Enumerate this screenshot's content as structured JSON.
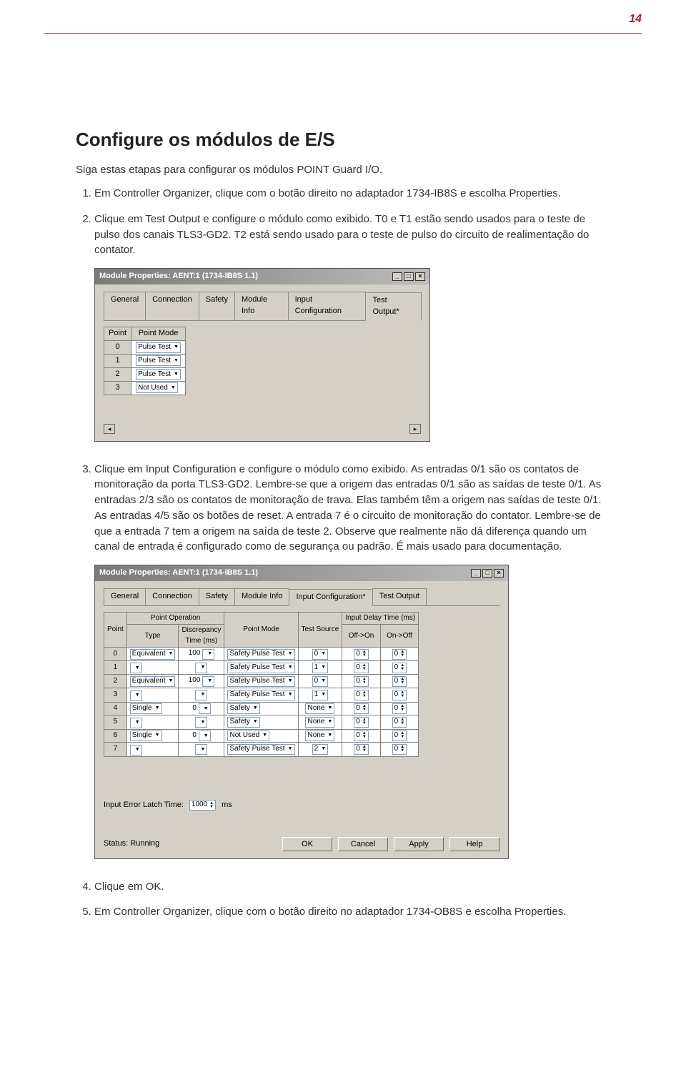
{
  "page_number": "14",
  "title": "Configure os módulos de E/S",
  "subtitle": "Siga estas etapas para configurar os módulos POINT Guard I/O.",
  "steps": {
    "s1": "Em Controller Organizer, clique com o botão direito no adaptador 1734-IB8S e escolha Properties.",
    "s2": "Clique em Test Output e configure o módulo como exibido. T0 e T1 estão sendo usados para o teste de pulso dos canais TLS3-GD2. T2 está sendo usado para o teste de pulso do circuito de realimentação do contator.",
    "s3": "Clique em Input Configuration e configure o módulo como exibido. As entradas 0/1 são os contatos de monitoração da porta TLS3-GD2. Lembre-se que a origem das entradas 0/1 são as saídas de teste 0/1. As entradas 2/3 são os contatos de monitoração de trava. Elas também têm a origem nas saídas de teste 0/1. As entradas 4/5 são os botões de reset. A entrada 7 é o circuito de monitoração do contator. Lembre-se de que a entrada 7 tem a origem na saída de teste 2. Observe que realmente não dá diferença quando um canal de entrada é configurado como de segurança ou padrão. É mais usado para documentação.",
    "s4": "Clique em OK.",
    "s5": "Em Controller Organizer, clique com o botão direito no adaptador 1734-OB8S e escolha Properties."
  },
  "dialog1": {
    "title": "Module Properties: AENT:1 (1734-IB8S 1.1)",
    "tabs": [
      "General",
      "Connection",
      "Safety",
      "Module Info",
      "Input Configuration",
      "Test Output*"
    ],
    "active_tab": 5,
    "col_point": "Point",
    "col_mode": "Point Mode",
    "rows": [
      {
        "idx": "0",
        "mode": "Pulse Test"
      },
      {
        "idx": "1",
        "mode": "Pulse Test"
      },
      {
        "idx": "2",
        "mode": "Pulse Test"
      },
      {
        "idx": "3",
        "mode": "Not Used"
      }
    ]
  },
  "dialog2": {
    "title": "Module Properties: AENT:1 (1734-IB8S 1.1)",
    "tabs": [
      "General",
      "Connection",
      "Safety",
      "Module Info",
      "Input Configuration*",
      "Test Output"
    ],
    "active_tab": 4,
    "headers": {
      "point": "Point",
      "point_op": "Point Operation",
      "type": "Type",
      "disc": "Discrepancy\nTime (ms)",
      "mode": "Point Mode",
      "test": "Test\nSource",
      "delay": "Input Delay Time (ms)",
      "offon": "Off->On",
      "onoff": "On->Off"
    },
    "rows": [
      {
        "idx": "0",
        "type": "Equivalent",
        "disc": "100",
        "mode": "Safety Pulse Test",
        "test": "0",
        "offon": "0",
        "onoff": "0"
      },
      {
        "idx": "1",
        "type": "",
        "disc": "",
        "mode": "Safety Pulse Test",
        "test": "1",
        "offon": "0",
        "onoff": "0"
      },
      {
        "idx": "2",
        "type": "Equivalent",
        "disc": "100",
        "mode": "Safety Pulse Test",
        "test": "0",
        "offon": "0",
        "onoff": "0"
      },
      {
        "idx": "3",
        "type": "",
        "disc": "",
        "mode": "Safety Pulse Test",
        "test": "1",
        "offon": "0",
        "onoff": "0"
      },
      {
        "idx": "4",
        "type": "Single",
        "disc": "0",
        "mode": "Safety",
        "test": "None",
        "offon": "0",
        "onoff": "0"
      },
      {
        "idx": "5",
        "type": "",
        "disc": "",
        "mode": "Safety",
        "test": "None",
        "offon": "0",
        "onoff": "0"
      },
      {
        "idx": "6",
        "type": "Single",
        "disc": "0",
        "mode": "Not Used",
        "test": "None",
        "offon": "0",
        "onoff": "0"
      },
      {
        "idx": "7",
        "type": "",
        "disc": "",
        "mode": "Safety Pulse Test",
        "test": "2",
        "offon": "0",
        "onoff": "0"
      }
    ],
    "latch_label": "Input Error Latch Time:",
    "latch_value": "1000",
    "latch_unit": "ms",
    "status": "Status: Running",
    "buttons": {
      "ok": "OK",
      "cancel": "Cancel",
      "apply": "Apply",
      "help": "Help"
    }
  }
}
